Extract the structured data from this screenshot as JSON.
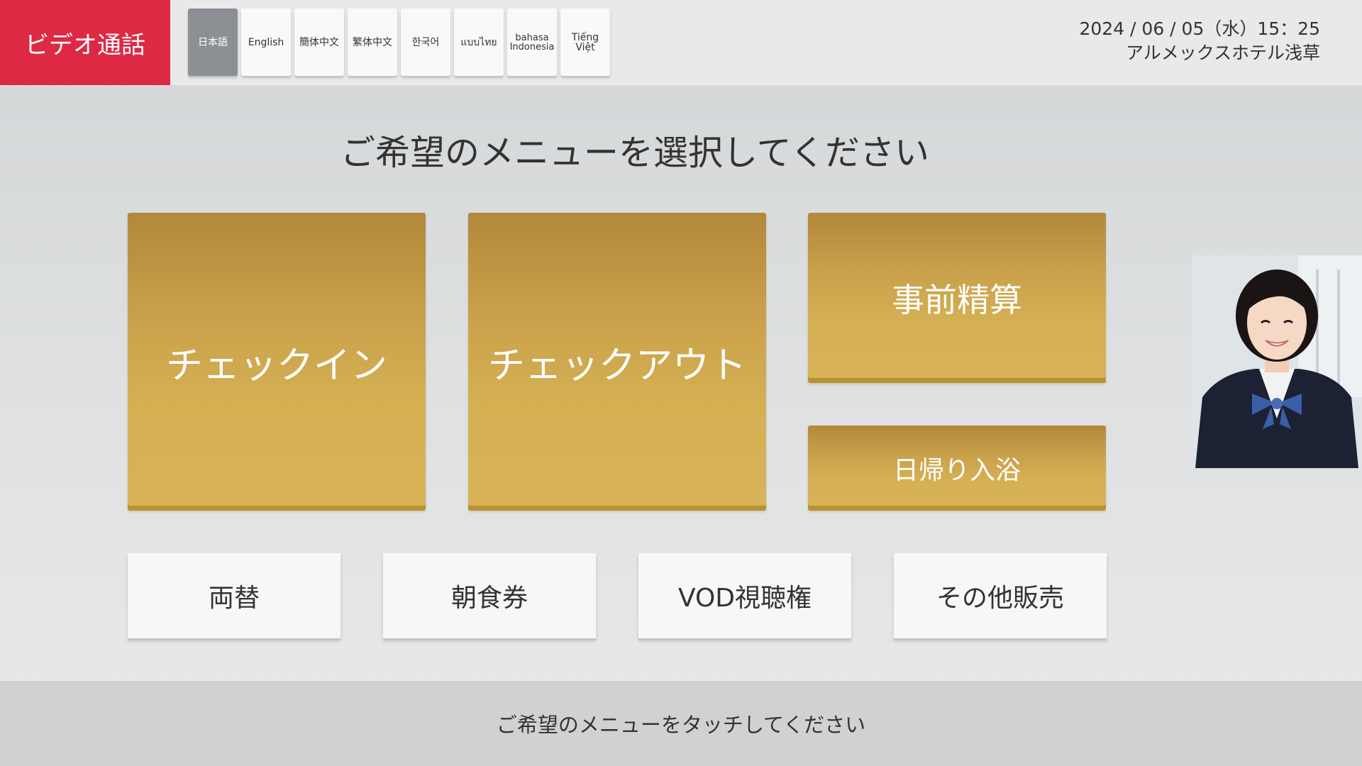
{
  "header": {
    "video_call_label": "ビデオ通話",
    "languages": [
      {
        "label": "日本語",
        "active": true
      },
      {
        "label": "English",
        "active": false
      },
      {
        "label": "簡体中文",
        "active": false
      },
      {
        "label": "繁体中文",
        "active": false
      },
      {
        "label": "한국어",
        "active": false
      },
      {
        "label": "แบบไทย",
        "active": false
      },
      {
        "label": "bahasa\nIndonesia",
        "active": false
      },
      {
        "label": "Tiếng Việt",
        "active": false
      }
    ],
    "datetime": "2024 / 06 / 05（水）15：25",
    "hotel_name": "アルメックスホテル浅草"
  },
  "main": {
    "title": "ご希望のメニューを選択してください",
    "primary_buttons": {
      "checkin": "チェックイン",
      "checkout": "チェックアウト",
      "prepay": "事前精算",
      "day_bath": "日帰り入浴"
    },
    "secondary_buttons": {
      "exchange": "両替",
      "breakfast": "朝食券",
      "vod": "VOD視聴権",
      "other_sales": "その他販売"
    }
  },
  "footer": {
    "message": "ご希望のメニューをタッチしてください"
  },
  "colors": {
    "video_call": "#de2944",
    "gold": "#d5b053",
    "active_lang": "#8c8f94"
  }
}
